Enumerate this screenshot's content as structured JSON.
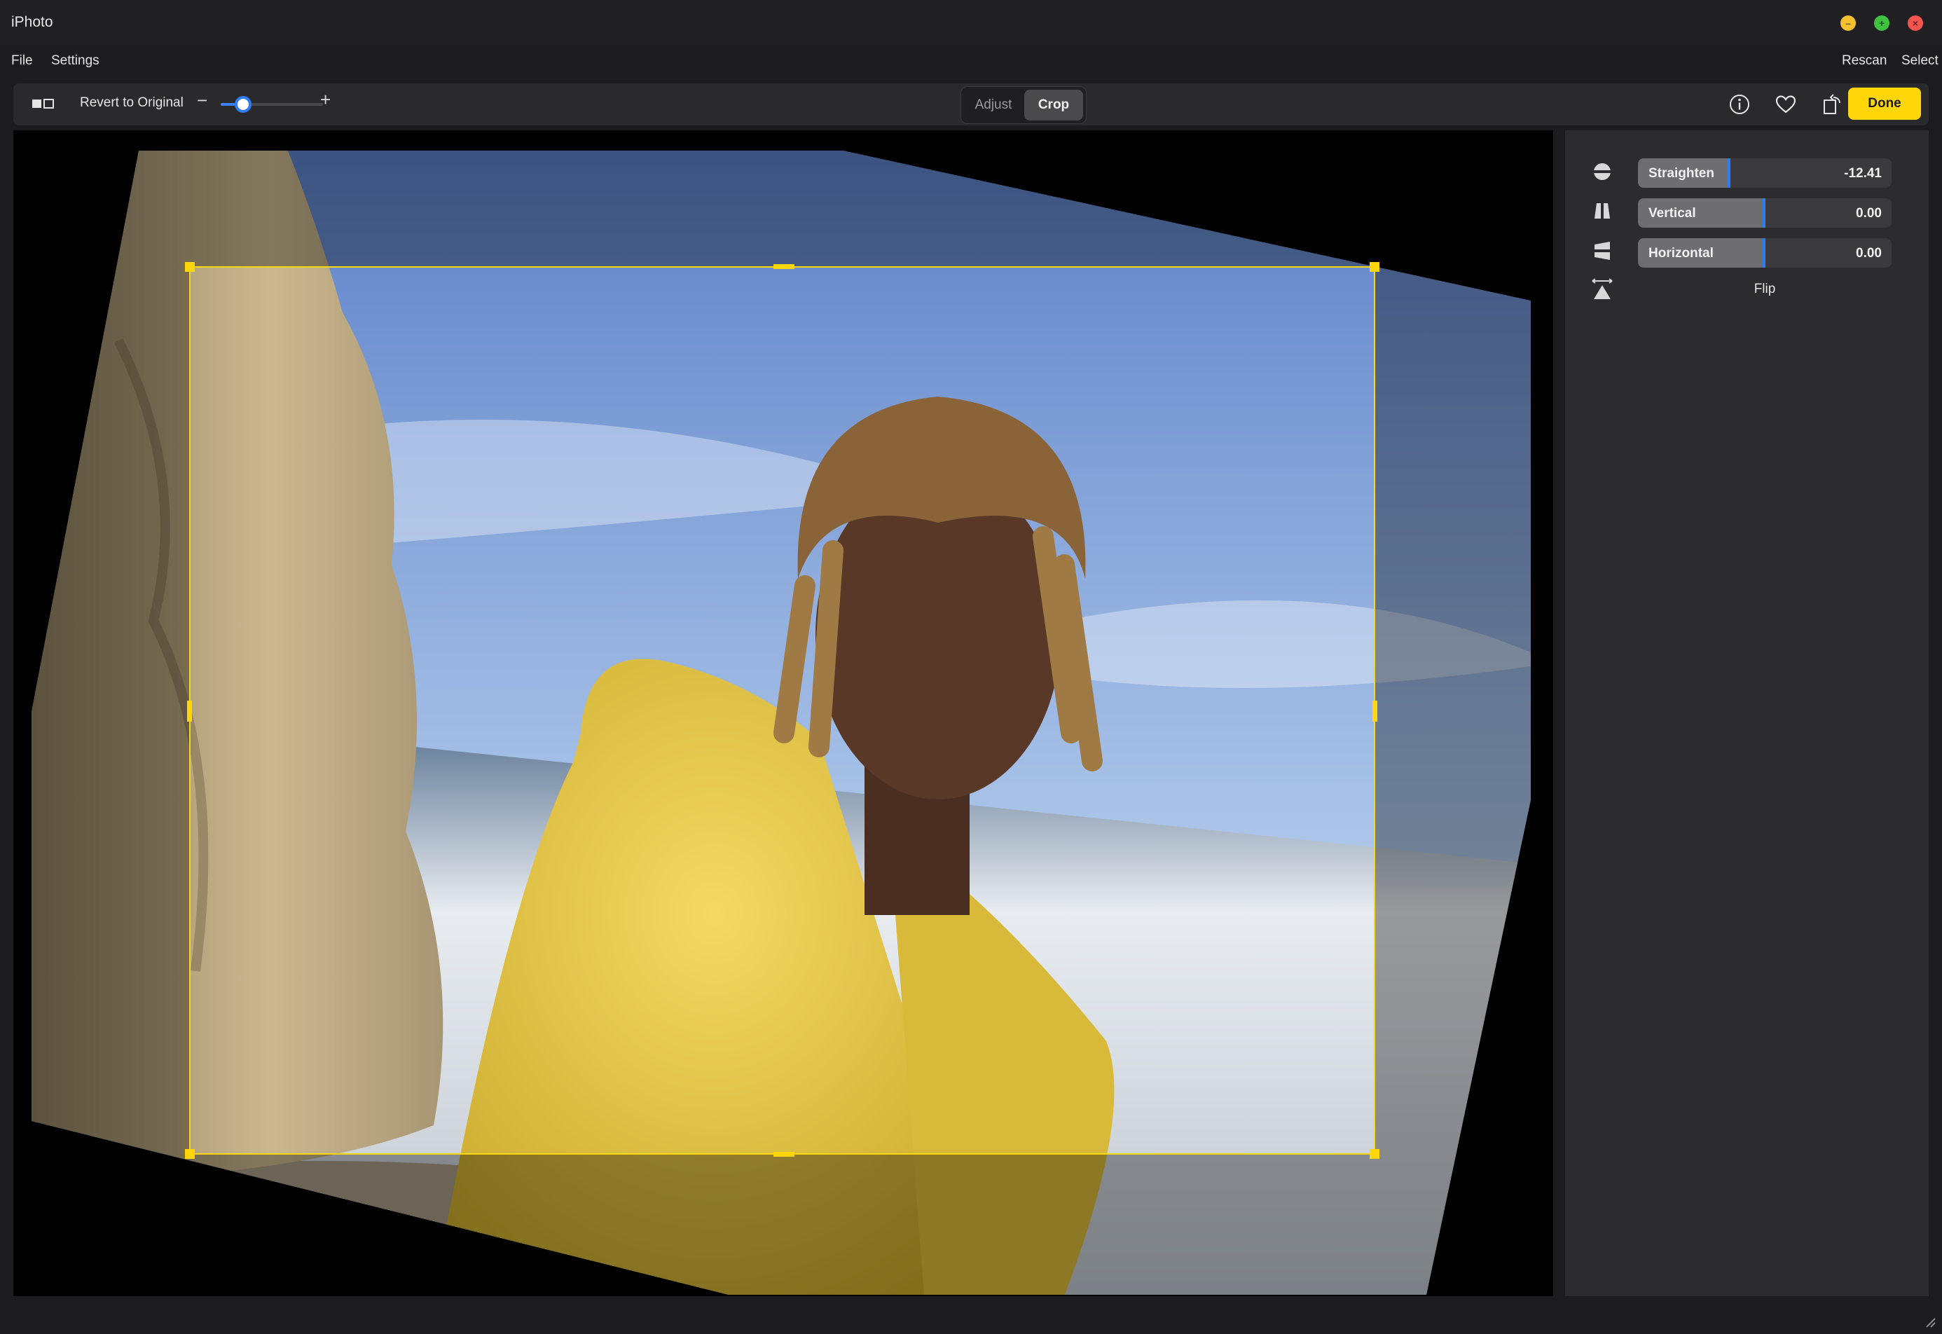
{
  "window": {
    "title": "iPhoto"
  },
  "menu": {
    "file": "File",
    "settings": "Settings",
    "rescan": "Rescan",
    "select": "Select"
  },
  "toolbar": {
    "revert_label": "Revert to Original",
    "zoom_minus": "−",
    "zoom_plus": "+",
    "zoom_level_fraction": 0.22,
    "tabs": {
      "adjust": "Adjust",
      "crop": "Crop"
    },
    "active_tab": "Crop",
    "done_label": "Done",
    "icons": [
      "compare-icon",
      "info-icon",
      "heart-icon",
      "rotate-icon"
    ]
  },
  "panel": {
    "straighten": {
      "label": "Straighten",
      "value": "-12.41"
    },
    "vertical": {
      "label": "Vertical",
      "value": "0.00"
    },
    "horizontal": {
      "label": "Horizontal",
      "value": "0.00"
    },
    "flip": {
      "label": "Flip"
    }
  },
  "colors": {
    "accent": "#ffd60a",
    "slider_marker": "#2f7df6",
    "background": "#1c1c1e"
  }
}
